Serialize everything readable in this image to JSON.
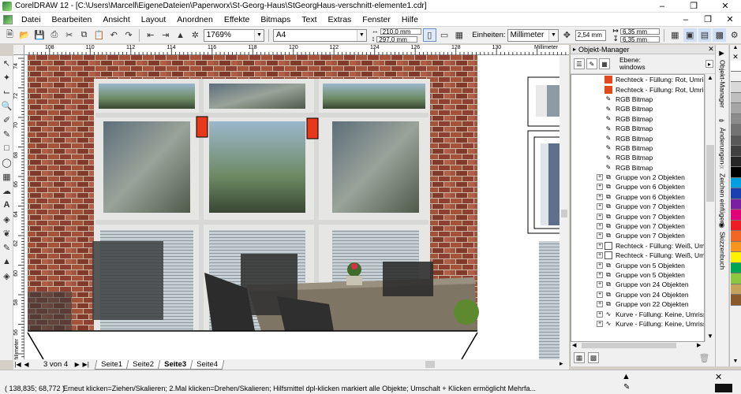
{
  "window": {
    "title": "CorelDRAW 12 - [C:\\Users\\Marcell\\EigeneDateien\\Paperworx\\St-Georg-Haus\\StGeorgHaus-verschnitt-elemente1.cdr]"
  },
  "menu": [
    "Datei",
    "Bearbeiten",
    "Ansicht",
    "Layout",
    "Anordnen",
    "Effekte",
    "Bitmaps",
    "Text",
    "Extras",
    "Fenster",
    "Hilfe"
  ],
  "toolbar": {
    "zoom": "1769%",
    "paper_size": "A4",
    "width": "210,0 mm",
    "height": "297,0 mm",
    "units_label": "Einheiten:",
    "units_value": "Millimeter",
    "nudge": "2,54 mm",
    "dup_x": "6,35 mm",
    "dup_y": "6,35 mm"
  },
  "ruler": {
    "h_ticks": [
      "108",
      "110",
      "112",
      "114",
      "116",
      "118",
      "120",
      "122",
      "124",
      "126",
      "128",
      "130"
    ],
    "unit_label": "Millimeter",
    "v_ticks": [
      "74",
      "72",
      "70",
      "68",
      "66",
      "64",
      "62",
      "60",
      "58",
      "56"
    ],
    "v_unit_label": "Millimeter"
  },
  "pages": {
    "count_label": "3 von 4",
    "tabs": [
      "Seite1",
      "Seite2",
      "Seite3",
      "Seite4"
    ],
    "active": "Seite3"
  },
  "docker": {
    "title": "Objekt-Manager",
    "layer_label": "Ebene:",
    "layer_name": "windows",
    "items": [
      {
        "label": "Rechteck - Füllung: Rot, Umriss",
        "kind": "rect-red",
        "expander": false
      },
      {
        "label": "Rechteck - Füllung: Rot, Umriss",
        "kind": "rect-red",
        "expander": false
      },
      {
        "label": "RGB Bitmap",
        "kind": "bitmap",
        "expander": false
      },
      {
        "label": "RGB Bitmap",
        "kind": "bitmap",
        "expander": false
      },
      {
        "label": "RGB Bitmap",
        "kind": "bitmap",
        "expander": false
      },
      {
        "label": "RGB Bitmap",
        "kind": "bitmap",
        "expander": false
      },
      {
        "label": "RGB Bitmap",
        "kind": "bitmap",
        "expander": false
      },
      {
        "label": "RGB Bitmap",
        "kind": "bitmap",
        "expander": false
      },
      {
        "label": "RGB Bitmap",
        "kind": "bitmap",
        "expander": false
      },
      {
        "label": "RGB Bitmap",
        "kind": "bitmap",
        "expander": false
      },
      {
        "label": "Gruppe von 2 Objekten",
        "kind": "group",
        "expander": true
      },
      {
        "label": "Gruppe von 6 Objekten",
        "kind": "group",
        "expander": true
      },
      {
        "label": "Gruppe von 6 Objekten",
        "kind": "group",
        "expander": true
      },
      {
        "label": "Gruppe von 7 Objekten",
        "kind": "group",
        "expander": true
      },
      {
        "label": "Gruppe von 7 Objekten",
        "kind": "group",
        "expander": true
      },
      {
        "label": "Gruppe von 7 Objekten",
        "kind": "group",
        "expander": true
      },
      {
        "label": "Gruppe von 7 Objekten",
        "kind": "group",
        "expander": true
      },
      {
        "label": "Rechteck - Füllung: Weiß, Umri",
        "kind": "rect-white",
        "expander": true
      },
      {
        "label": "Rechteck - Füllung: Weiß, Umri",
        "kind": "rect-white",
        "expander": true
      },
      {
        "label": "Gruppe von 5 Objekten",
        "kind": "group",
        "expander": true
      },
      {
        "label": "Gruppe von 5 Objekten",
        "kind": "group",
        "expander": true
      },
      {
        "label": "Gruppe von 24 Objekten",
        "kind": "group",
        "expander": true
      },
      {
        "label": "Gruppe von 24 Objekten",
        "kind": "group",
        "expander": true
      },
      {
        "label": "Gruppe von 22 Objekten",
        "kind": "group",
        "expander": true
      },
      {
        "label": "Kurve - Füllung: Keine, Umriss:",
        "kind": "curve",
        "expander": true
      },
      {
        "label": "Kurve - Füllung: Keine, Umriss:",
        "kind": "curve",
        "expander": true
      }
    ]
  },
  "side_tabs": [
    "Objekt-Manager",
    "Änderungen",
    "Zeichen einfügen",
    "Skizzenbuch"
  ],
  "palette": [
    "#ffffff",
    "#f2f2f2",
    "#d9d9d9",
    "#bfbfbf",
    "#a6a6a6",
    "#8c8c8c",
    "#737373",
    "#595959",
    "#404040",
    "#262626",
    "#000000",
    "#00a0e0",
    "#1a3fb0",
    "#7a1fa2",
    "#e0007a",
    "#ee1c24",
    "#f26522",
    "#f7941d",
    "#fff200",
    "#00a651",
    "#8dc63f",
    "#c4a35a",
    "#8b5a2b"
  ],
  "status": {
    "coords": "( 138,835; 68,772 )",
    "hint": "Erneut klicken=Ziehen/Skalieren; 2.Mal klicken=Drehen/Skalieren; Hilfsmittel dpl-klicken markiert alle Objekte; Umschalt + Klicken ermöglicht Mehrfa..."
  }
}
